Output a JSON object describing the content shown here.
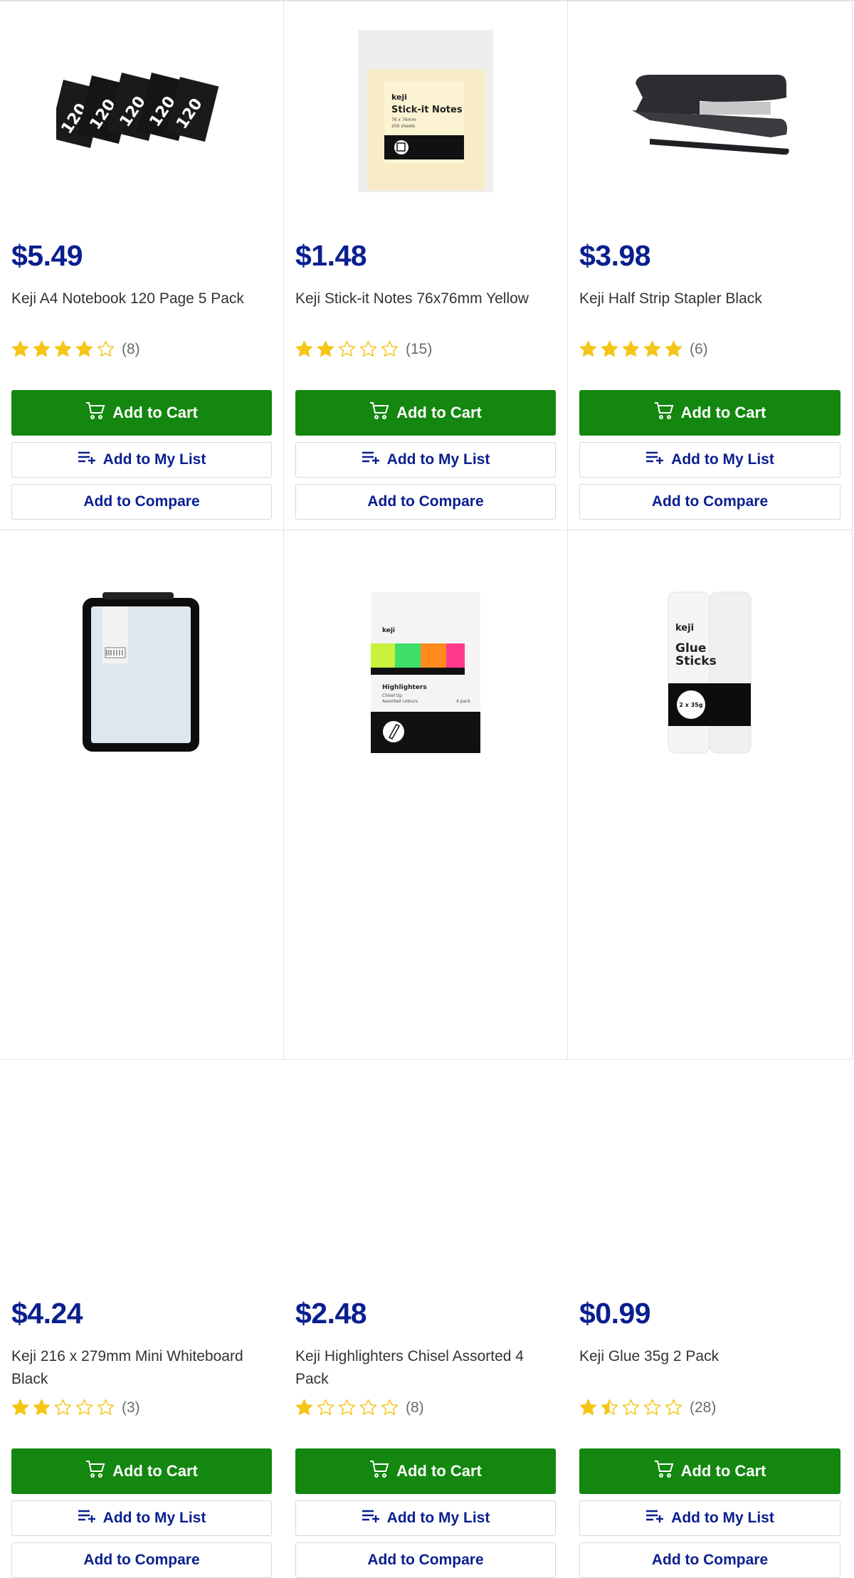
{
  "buttons": {
    "add_to_cart": "Add to Cart",
    "add_to_list": "Add to My List",
    "add_to_compare": "Add to Compare"
  },
  "colors": {
    "price": "#0a1f8f",
    "cart_button": "#13870f",
    "star": "#f5c518"
  },
  "products": [
    {
      "price": "$5.49",
      "title": "Keji A4 Notebook 120 Page 5 Pack",
      "rating": 4,
      "rating_count": "(8)",
      "image_icon": "notebook-pack-image"
    },
    {
      "price": "$1.48",
      "title": "Keji Stick-it Notes 76x76mm Yellow",
      "rating": 2,
      "rating_count": "(15)",
      "image_icon": "sticky-notes-image"
    },
    {
      "price": "$3.98",
      "title": "Keji Half Strip Stapler Black",
      "rating": 5,
      "rating_count": "(6)",
      "image_icon": "stapler-image"
    },
    {
      "price": "$4.24",
      "title": "Keji 216 x 279mm Mini Whiteboard Black",
      "rating": 2,
      "rating_count": "(3)",
      "image_icon": "whiteboard-image"
    },
    {
      "price": "$2.48",
      "title": "Keji Highlighters Chisel Assorted 4 Pack",
      "rating": 1,
      "rating_count": "(8)",
      "image_icon": "highlighters-image"
    },
    {
      "price": "$0.99",
      "title": "Keji Glue 35g 2 Pack",
      "rating": 1.5,
      "rating_count": "(28)",
      "image_icon": "glue-sticks-image"
    }
  ],
  "image_text": {
    "notebook_number": "120",
    "brand": "keji",
    "sticky_title": "Stick-it Notes",
    "sticky_sub1": "76 x 76mm",
    "sticky_sub2": "200 sheets",
    "highlighter_title": "Highlighters",
    "highlighter_sub1": "Chisel tip",
    "highlighter_sub2": "Assorted colours",
    "highlighter_pack": "4 pack",
    "glue_title1": "Glue",
    "glue_title2": "Sticks",
    "glue_size": "2 x 35g"
  }
}
